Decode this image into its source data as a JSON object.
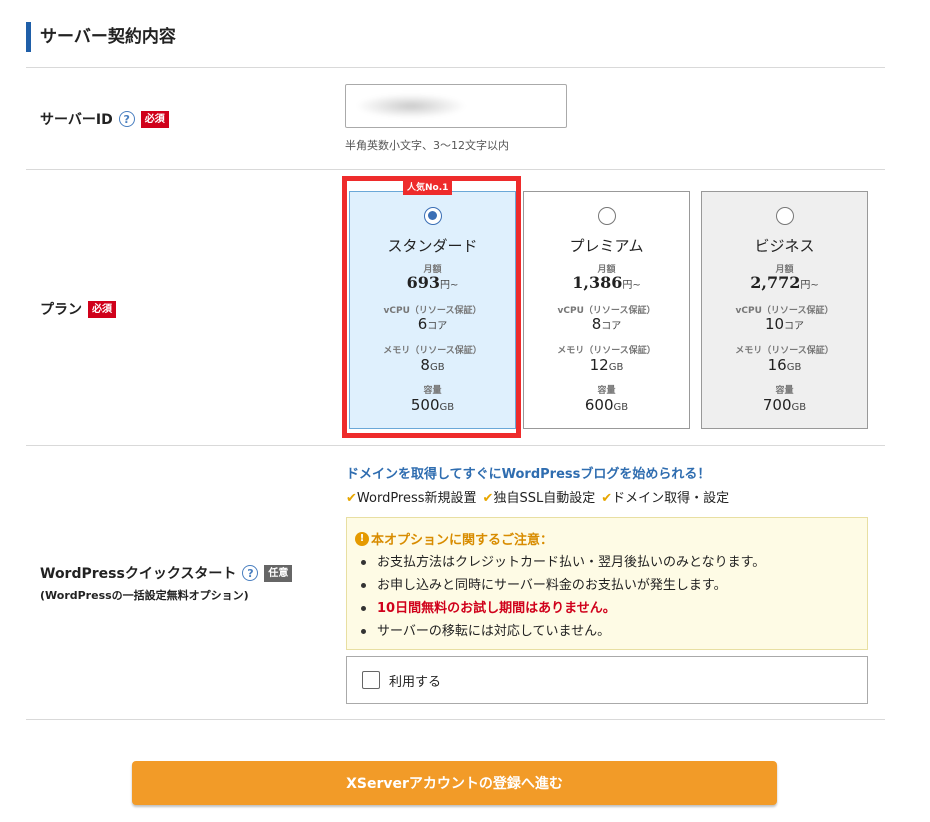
{
  "section": {
    "title": "サーバー契約内容"
  },
  "server_id": {
    "label": "サーバーID",
    "help": "?",
    "required_badge": "必須",
    "value": "",
    "note": "半角英数小文字、3～12文字以内"
  },
  "plan": {
    "label": "プラン",
    "required_badge": "必須",
    "popular_tag": "人気No.1",
    "price_label": "月額",
    "price_unit": "円~",
    "vcpu_label": "vCPU（リソース保証）",
    "core_unit": "コア",
    "memory_label": "メモリ（リソース保証）",
    "storage_label": "容量",
    "gb_unit": "GB",
    "cards": [
      {
        "name": "スタンダード",
        "price": "693",
        "vcpu": "6",
        "memory": "8",
        "storage": "500",
        "selected": true
      },
      {
        "name": "プレミアム",
        "price": "1,386",
        "vcpu": "8",
        "memory": "12",
        "storage": "600",
        "selected": false
      },
      {
        "name": "ビジネス",
        "price": "2,772",
        "vcpu": "10",
        "memory": "16",
        "storage": "700",
        "selected": false
      }
    ]
  },
  "wordpress": {
    "label": "WordPressクイックスタート",
    "help": "?",
    "optional_badge": "任意",
    "sub_label": "(WordPressの一括設定無料オプション)",
    "headline": "ドメインを取得してすぐにWordPressブログを始められる！",
    "features": [
      "WordPress新規設置",
      "独自SSL自動設定",
      "ドメイン取得・設定"
    ],
    "notice_title": "本オプションに関するご注意：",
    "notice_items": [
      "お支払方法はクレジットカード払い・翌月後払いのみとなります。",
      "お申し込みと同時にサーバー料金のお支払いが発生します。",
      "10日間無料のお試し期間はありません。",
      "サーバーの移転には対応していません。"
    ],
    "use_label": "利用する"
  },
  "cta": {
    "label": "XServerアカウントの登録へ進む"
  },
  "colors": {
    "accent": "#1f5fa8",
    "highlight": "#ee2b2b",
    "cta": "#f29b28",
    "required": "#d0011b"
  },
  "icons": {
    "help": "question-circle-icon",
    "check": "check-icon",
    "warning": "exclamation-circle-icon"
  }
}
